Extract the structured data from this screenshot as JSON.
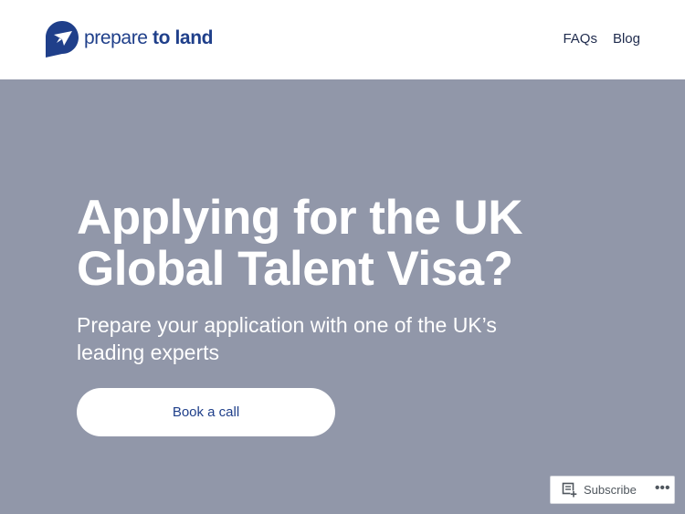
{
  "header": {
    "logo": {
      "text_light": "prepare ",
      "text_bold": "to land",
      "icon": "logo-plane-icon",
      "color": "#1f3f8a"
    },
    "nav": [
      {
        "label": "FAQs"
      },
      {
        "label": "Blog"
      }
    ]
  },
  "hero": {
    "title": "Applying for the UK Global Talent Visa?",
    "subtitle": "Prepare your application with one of the UK’s leading experts",
    "cta_label": "Book a call",
    "background": "#9197a9"
  },
  "subscribe_bar": {
    "icon": "subscribe-icon",
    "label": "Subscribe",
    "more_label": "•••"
  }
}
